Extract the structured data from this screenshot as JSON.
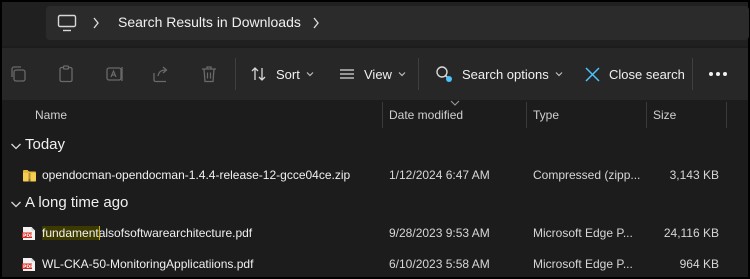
{
  "address_bar": {
    "breadcrumb": "Search Results in Downloads"
  },
  "toolbar": {
    "sort_label": "Sort",
    "view_label": "View",
    "search_options_label": "Search options",
    "close_search_label": "Close search",
    "more_label": "•••"
  },
  "columns": {
    "name": "Name",
    "date_modified": "Date modified",
    "type": "Type",
    "size": "Size"
  },
  "groups": [
    {
      "title": "Today",
      "files": [
        {
          "name": "opendocman-opendocman-1.4.4-release-12-gcce04ce.zip",
          "date": "1/12/2024 6:47 AM",
          "type": "Compressed (zipp...",
          "size": "3,143 KB",
          "icon": "zip-folder-icon"
        }
      ]
    },
    {
      "title": "A long time ago",
      "files": [
        {
          "name_highlight": "fundament",
          "name_rest": "alsofsoftwarearchitecture.pdf",
          "date": "9/28/2023 9:53 AM",
          "type": "Microsoft Edge P...",
          "size": "24,116 KB",
          "icon": "pdf-icon"
        },
        {
          "name": "WL-CKA-50-MonitoringApplicatiions.pdf",
          "date": "6/10/2023 5:58 AM",
          "type": "Microsoft Edge P...",
          "size": "964 KB",
          "icon": "pdf-icon"
        }
      ]
    }
  ],
  "colors": {
    "background": "#1c1c1c",
    "toolbar": "#272727",
    "accent": "#4cc2ff",
    "highlight_border": "#c8b400"
  }
}
